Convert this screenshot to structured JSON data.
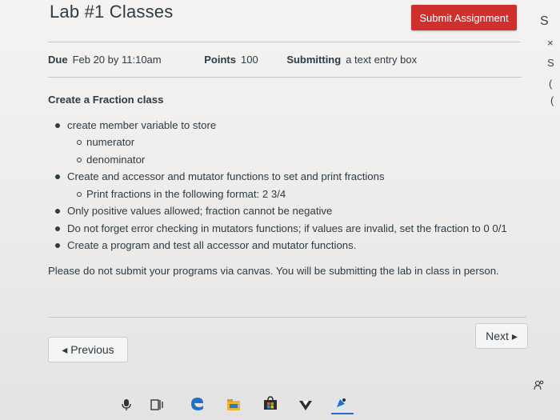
{
  "header": {
    "title": "Lab #1 Classes",
    "submit_label": "Submit Assignment",
    "side_letters": [
      "S",
      "×",
      "S",
      "(",
      "("
    ]
  },
  "details": {
    "due_label": "Due",
    "due_value": "Feb 20 by 11:10am",
    "points_label": "Points",
    "points_value": "100",
    "submitting_label": "Submitting",
    "submitting_value": "a text entry box"
  },
  "content": {
    "heading": "Create a Fraction class",
    "bullets": [
      {
        "text": "create member variable to store",
        "sub": [
          "numerator",
          "denominator"
        ]
      },
      {
        "text": "Create and accessor and mutator functions to set and print fractions",
        "sub": [
          "Print fractions in the following format: 2 3/4"
        ]
      },
      {
        "text": "Only positive values  allowed; fraction cannot be negative",
        "sub": []
      },
      {
        "text": "Do not forget error checking in mutators functions; if values are invalid, set the fraction to 0 0/1",
        "sub": []
      },
      {
        "text": "Create a program and test all accessor  and mutator functions.",
        "sub": []
      }
    ],
    "note": "Please do not submit your programs via canvas. You will be submitting the lab in class in person."
  },
  "nav": {
    "previous_label": "◂ Previous",
    "next_label": "Next ▸"
  },
  "colors": {
    "submit_bg": "#d0302d",
    "text": "#2d3b45",
    "edge_blue": "#1e73c8"
  },
  "taskbar": {
    "icons": [
      "microphone-icon",
      "task-view-icon",
      "edge-icon",
      "file-explorer-icon",
      "store-icon",
      "arrow-app-icon",
      "paint-app-icon",
      "people-icon"
    ]
  }
}
